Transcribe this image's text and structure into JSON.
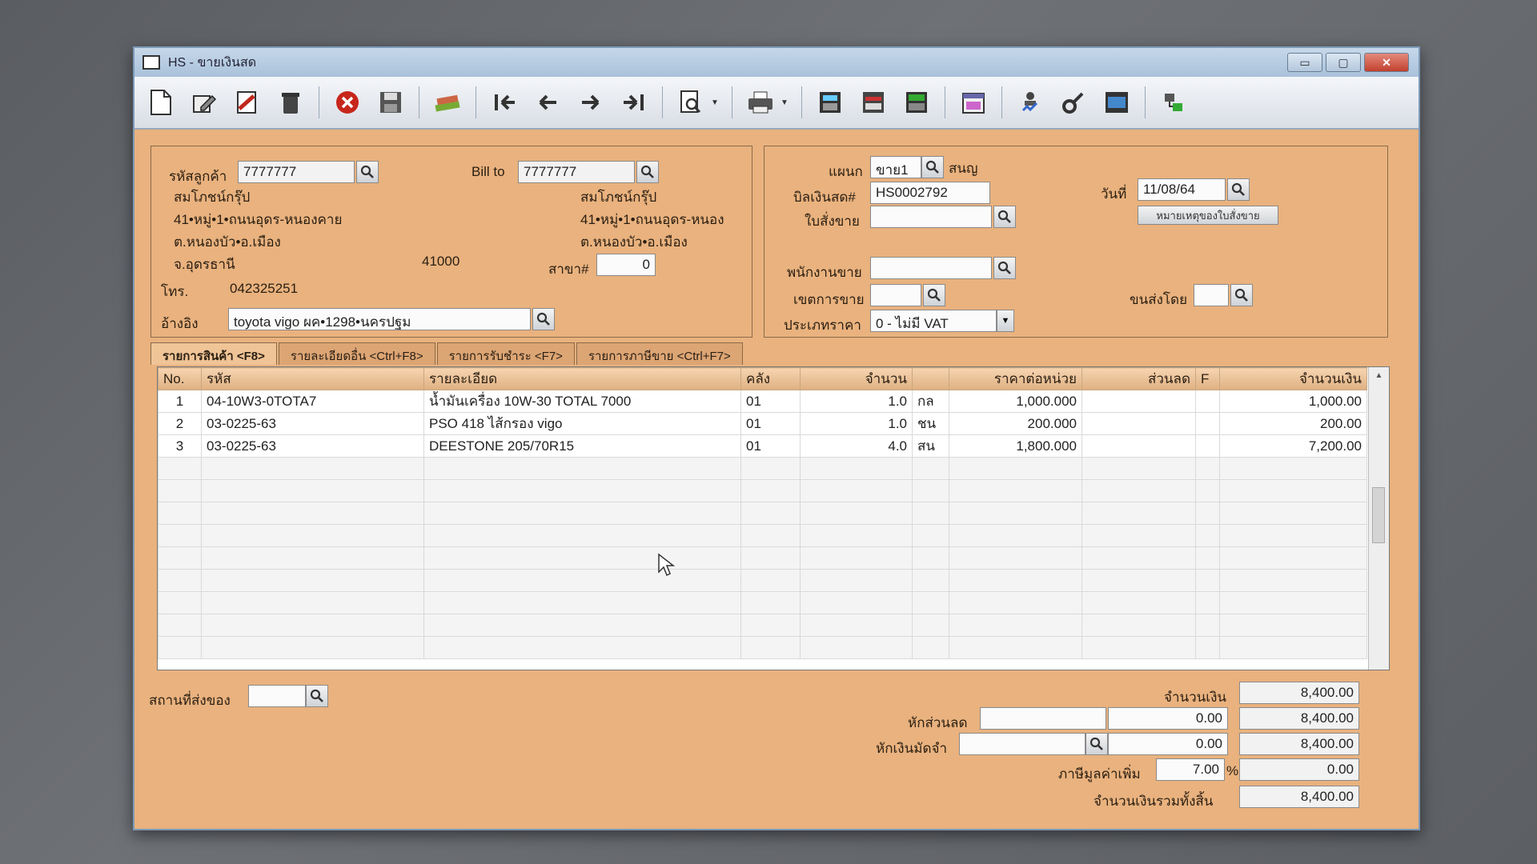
{
  "window": {
    "title": "HS - ขายเงินสด",
    "controls": {
      "minimize": "▭",
      "maximize": "▢",
      "close": "✕"
    }
  },
  "toolbar": {
    "buttons": [
      "new-doc-icon",
      "edit-icon",
      "void-icon",
      "trash-icon",
      "cancel-icon",
      "save-icon",
      "books-icon",
      "first-record-icon",
      "prev-record-icon",
      "next-record-icon",
      "last-record-icon",
      "search-doc-icon",
      "print-icon",
      "calculator-icon",
      "printer-list-icon",
      "stock-icon",
      "calendar-icon",
      "approve-icon",
      "tools-icon",
      "ok-icon",
      "network-icon"
    ]
  },
  "customer": {
    "code_label": "รหัสลูกค้า",
    "code_value": "7777777",
    "name": "สมโภชน์กรุ๊ป",
    "address1": "41•หมู่•1•ถนนอุดร-หนองคาย",
    "address2": "ต.หนองบัว•อ.เมือง",
    "address3": "จ.อุดรธานี",
    "zip": "41000",
    "phone_label": "โทร.",
    "phone": "042325251",
    "ref_label": "อ้างอิง",
    "ref_value": "toyota vigo ผค•1298•นครปฐม"
  },
  "bill_to": {
    "label": "Bill to",
    "value": "7777777",
    "name": "สมโภชน์กรุ๊ป",
    "address1": "41•หมู่•1•ถนนอุดร-หนอง",
    "address2": "ต.หนองบัว•อ.เมือง",
    "branch_label": "สาขา#",
    "branch_value": "0"
  },
  "doc": {
    "dept_label": "แผนก",
    "dept_value": "ขาย1",
    "dept_name": "สนญ",
    "cash_bill_label": "บิลเงินสด#",
    "cash_bill_value": "HS0002792",
    "date_label": "วันที่",
    "date_value": "11/08/64",
    "order_label": "ใบสั่งขาย",
    "order_note_button": "หมายเหตุของใบสั่งขาย",
    "salesman_label": "พนักงานขาย",
    "area_label": "เขตการขาย",
    "ship_by_label": "ขนส่งโดย",
    "price_type_label": "ประเภทราคา",
    "price_type_value": "0 - ไม่มี VAT"
  },
  "tabs": [
    {
      "label": "รายการสินค้า <F8>"
    },
    {
      "label": "รายละเอียดอื่น <Ctrl+F8>"
    },
    {
      "label": "รายการรับชำระ <F7>"
    },
    {
      "label": "รายการภาษีขาย <Ctrl+F7>"
    }
  ],
  "grid": {
    "headers": [
      "No.",
      "รหัส",
      "รายละเอียด",
      "คลัง",
      "จำนวน",
      "",
      "ราคาต่อหน่วย",
      "ส่วนลด",
      "F",
      "จำนวนเงิน"
    ],
    "rows": [
      {
        "no": "1",
        "code": "04-10W3-0TOTA7",
        "desc": "น้ำมันเครื่อง 10W-30 TOTAL 7000",
        "wh": "01",
        "qty": "1.0",
        "unit": "กล",
        "price": "1,000.000",
        "disc": "",
        "f": "",
        "amount": "1,000.00"
      },
      {
        "no": "2",
        "code": "03-0225-63",
        "desc": "PSO 418 ไส้กรอง vigo",
        "wh": "01",
        "qty": "1.0",
        "unit": "ชน",
        "price": "200.000",
        "disc": "",
        "f": "",
        "amount": "200.00"
      },
      {
        "no": "3",
        "code": "03-0225-63",
        "desc": "DEESTONE 205/70R15",
        "wh": "01",
        "qty": "4.0",
        "unit": "สน",
        "price": "1,800.000",
        "disc": "",
        "f": "",
        "amount": "7,200.00"
      }
    ]
  },
  "footer": {
    "delivery_label": "สถานที่ส่งของ",
    "amount_label": "จำนวนเงิน",
    "amount_value": "8,400.00",
    "discount_label": "หักส่วนลด",
    "discount_value": "0.00",
    "after_discount": "8,400.00",
    "deposit_label": "หักเงินมัดจำ",
    "deposit_value": "0.00",
    "after_deposit": "8,400.00",
    "vat_label": "ภาษีมูลค่าเพิ่ม",
    "vat_rate": "7.00",
    "vat_pct": "%",
    "vat_value": "0.00",
    "total_label": "จำนวนเงินรวมทั้งสิ้น",
    "total_value": "8,400.00"
  }
}
